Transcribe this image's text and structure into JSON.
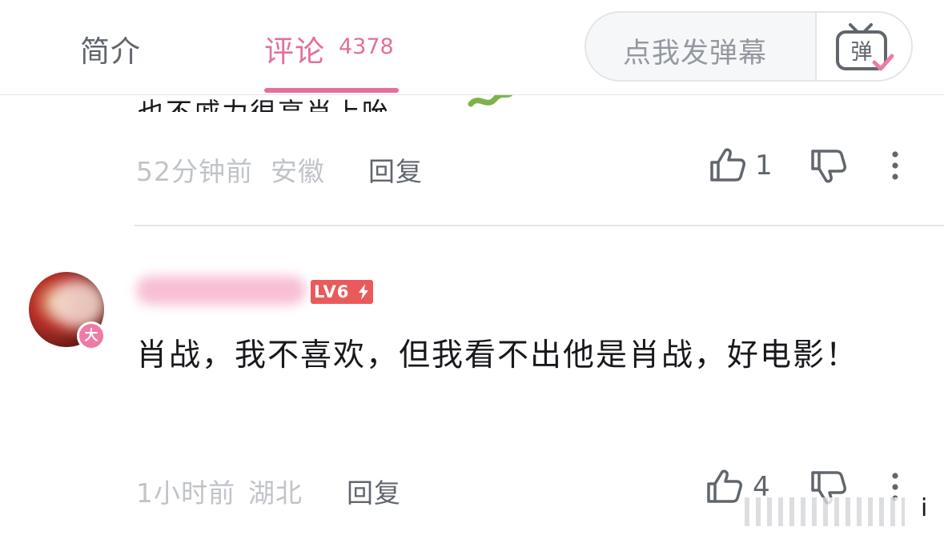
{
  "header": {
    "tab_intro": "简介",
    "tab_comments": "评论",
    "comment_count": "4378",
    "danmaku_placeholder": "点我发弹幕",
    "danmaku_icon_char": "弹"
  },
  "comments": [
    {
      "clipped_text": "也不戚力很高肖上吮",
      "time": "52分钟前",
      "location": "安徽",
      "reply_label": "回复",
      "likes": "1"
    },
    {
      "vip_char": "大",
      "level": "LV6",
      "text": "肖战，我不喜欢，但我看不出他是肖战，好电影！",
      "time": "1小时前",
      "location": "湖北",
      "reply_label": "回复",
      "likes": "4"
    }
  ],
  "bottom": {
    "trailing_char": "i"
  },
  "colors": {
    "accent_pink": "#e2709e",
    "level_red": "#e95b5b",
    "meta_gray": "#c0c4c9"
  }
}
